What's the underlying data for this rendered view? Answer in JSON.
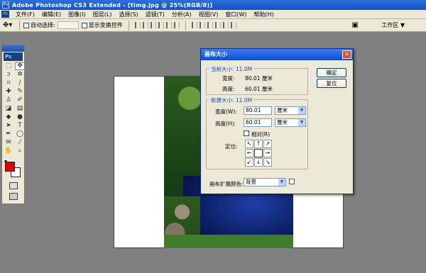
{
  "window": {
    "title": "Adobe Photoshop CS3 Extended - [timg.jpg @ 25%(RGB/8)]"
  },
  "menu": [
    "文件(F)",
    "编辑(E)",
    "图像(I)",
    "图层(L)",
    "选择(S)",
    "滤镜(T)",
    "分析(A)",
    "视图(V)",
    "窗口(W)",
    "帮助(H)"
  ],
  "options": {
    "auto_select_label": "自动选择:",
    "show_transform_label": "显示变换控件",
    "workspace_label": "工作区 ▼"
  },
  "toolbox": {
    "brand": "Ps"
  },
  "colors": {
    "foreground": "#e00000",
    "background": "#ffffff"
  },
  "dialog": {
    "title": "画布大小",
    "current_size": {
      "title": "当前大小: 11.0M",
      "width_label": "宽度:",
      "width_value": "80.01 厘米",
      "height_label": "高度:",
      "height_value": "60.01 厘米"
    },
    "new_size": {
      "title": "新建大小: 11.0M",
      "width_label": "宽度(W):",
      "width_value": "80.01",
      "width_unit": "厘米",
      "height_label": "高度(H):",
      "height_value": "60.01",
      "height_unit": "厘米",
      "relative_label": "相对(R)",
      "anchor_label": "定位:"
    },
    "ext_color_label": "画布扩展颜色:",
    "ext_color_value": "背景",
    "ok_label": "确定",
    "reset_label": "复位"
  }
}
